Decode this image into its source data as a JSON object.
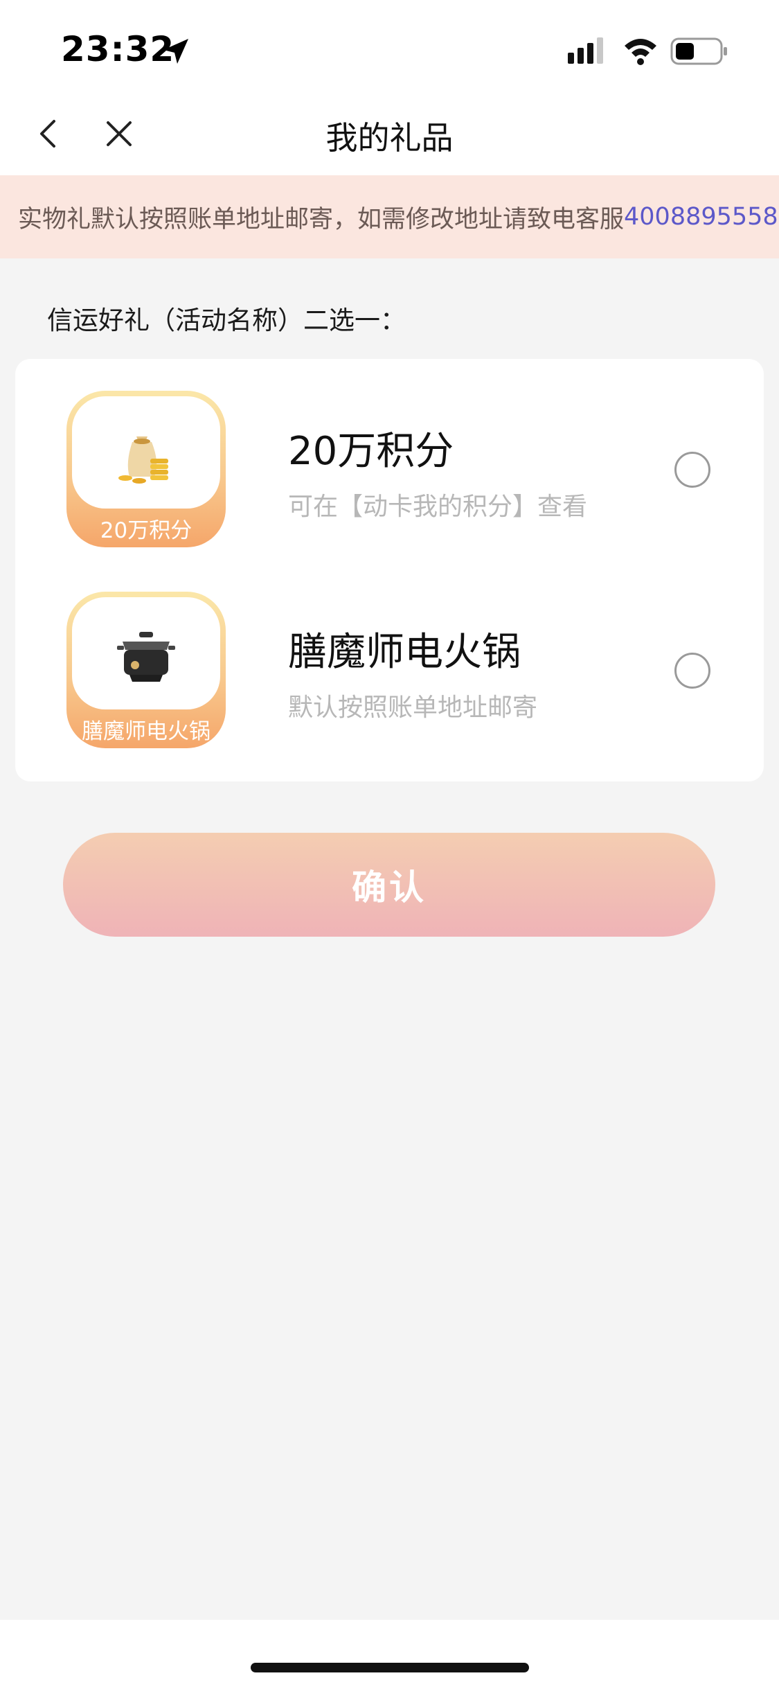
{
  "status_bar": {
    "time": "23:32",
    "icons": [
      "location-arrow-icon",
      "cellular-signal-icon",
      "wifi-icon",
      "battery-icon"
    ]
  },
  "nav": {
    "title": "我的礼品",
    "icons": [
      "back-chevron-icon",
      "close-icon"
    ]
  },
  "notice": {
    "text": "实物礼默认按照账单地址邮寄，如需修改地址请致电客服",
    "phone": "4008895558"
  },
  "section": {
    "title": "信运好礼（活动名称）二选一："
  },
  "gifts": [
    {
      "thumb_label": "20万积分",
      "name": "20万积分",
      "desc": "可在【动卡我的积分】查看",
      "icon": "money-bag-coins-icon",
      "selected": false
    },
    {
      "thumb_label": "膳魔师电火锅",
      "name": "膳魔师电火锅",
      "desc": "默认按照账单地址邮寄",
      "icon": "electric-hot-pot-icon",
      "selected": false
    }
  ],
  "confirm_button": {
    "label": "确认"
  },
  "colors": {
    "page_bg": "#f4f4f4",
    "notice_bg": "#fbe6df",
    "phone_link": "#5c58c9",
    "button_gradient_top": "#f4cdb1",
    "button_gradient_bottom": "#efb3b7",
    "thumb_gradient_top": "#fbe7a9",
    "thumb_gradient_bottom": "#f5a66a"
  }
}
